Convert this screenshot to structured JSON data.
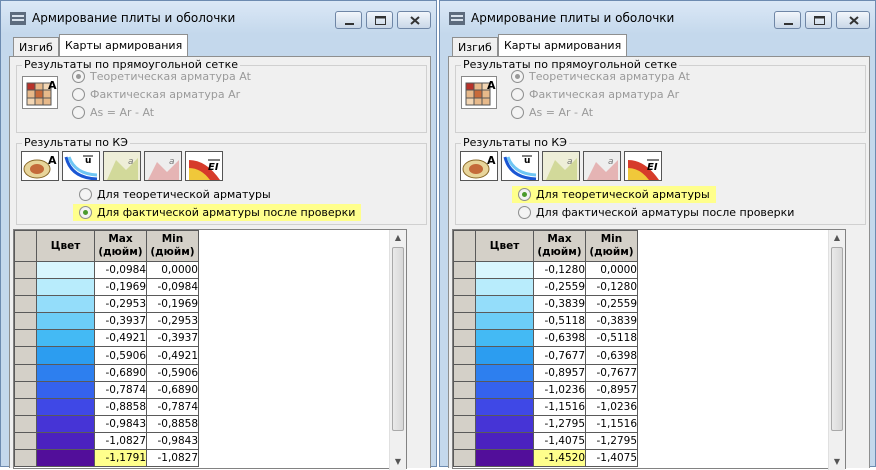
{
  "windows": [
    {
      "title": "Армирование плиты и оболочки",
      "tabs": [
        "Изгиб",
        "Карты армирования"
      ],
      "rect_group": {
        "title": "Результаты по прямоугольной сетке",
        "options": [
          "Теоретическая арматура At",
          "Фактическая арматура Ar",
          "As = Ar - At"
        ]
      },
      "fe_group": {
        "title": "Результаты по КЭ",
        "options": [
          "Для теоретической арматуры",
          "Для фактической арматуры после проверки"
        ],
        "selected": 1
      },
      "table": {
        "headers": [
          "Цвет",
          "Max\n(дюйм)",
          "Min\n(дюйм)"
        ],
        "rows": [
          {
            "color": "#d8f6fe",
            "max": "-0,0984",
            "min": "0,0000"
          },
          {
            "color": "#b8ecfc",
            "max": "-0,1969",
            "min": "-0,0984"
          },
          {
            "color": "#94ddfa",
            "max": "-0,2953",
            "min": "-0,1969"
          },
          {
            "color": "#6ccdf7",
            "max": "-0,3937",
            "min": "-0,2953"
          },
          {
            "color": "#44baf4",
            "max": "-0,4921",
            "min": "-0,3937"
          },
          {
            "color": "#2c9df0",
            "max": "-0,5906",
            "min": "-0,4921"
          },
          {
            "color": "#2d7fef",
            "max": "-0,6890",
            "min": "-0,5906"
          },
          {
            "color": "#3562ed",
            "max": "-0,7874",
            "min": "-0,6890"
          },
          {
            "color": "#3f48e6",
            "max": "-0,8858",
            "min": "-0,7874"
          },
          {
            "color": "#4634d6",
            "max": "-0,9843",
            "min": "-0,8858"
          },
          {
            "color": "#4b21bf",
            "max": "-1,0827",
            "min": "-0,9843"
          },
          {
            "color": "#520e9a",
            "max": "-1,1791",
            "min": "-1,0827"
          }
        ],
        "highlight_row": 11
      }
    },
    {
      "title": "Армирование плиты и оболочки",
      "tabs": [
        "Изгиб",
        "Карты армирования"
      ],
      "rect_group": {
        "title": "Результаты по прямоугольной сетке",
        "options": [
          "Теоретическая арматура At",
          "Фактическая арматура Ar",
          "As = Ar - At"
        ]
      },
      "fe_group": {
        "title": "Результаты по КЭ",
        "options": [
          "Для теоретической арматуры",
          "Для фактической арматуры после проверки"
        ],
        "selected": 0
      },
      "table": {
        "headers": [
          "Цвет",
          "Max\n(дюйм)",
          "Min\n(дюйм)"
        ],
        "rows": [
          {
            "color": "#d8f6fe",
            "max": "-0,1280",
            "min": "0,0000"
          },
          {
            "color": "#b8ecfc",
            "max": "-0,2559",
            "min": "-0,1280"
          },
          {
            "color": "#94ddfa",
            "max": "-0,3839",
            "min": "-0,2559"
          },
          {
            "color": "#6ccdf7",
            "max": "-0,5118",
            "min": "-0,3839"
          },
          {
            "color": "#44baf4",
            "max": "-0,6398",
            "min": "-0,5118"
          },
          {
            "color": "#2c9df0",
            "max": "-0,7677",
            "min": "-0,6398"
          },
          {
            "color": "#2d7fef",
            "max": "-0,8957",
            "min": "-0,7677"
          },
          {
            "color": "#3562ed",
            "max": "-1,0236",
            "min": "-0,8957"
          },
          {
            "color": "#3f48e6",
            "max": "-1,1516",
            "min": "-1,0236"
          },
          {
            "color": "#4634d6",
            "max": "-1,2795",
            "min": "-1,1516"
          },
          {
            "color": "#4b21bf",
            "max": "-1,4075",
            "min": "-1,2795"
          },
          {
            "color": "#520e9a",
            "max": "-1,4520",
            "min": "-1,4075"
          }
        ],
        "highlight_row": 11
      }
    }
  ],
  "colors": {
    "highlight": "#ffff8c",
    "window_frame": "#c4d8ec"
  }
}
